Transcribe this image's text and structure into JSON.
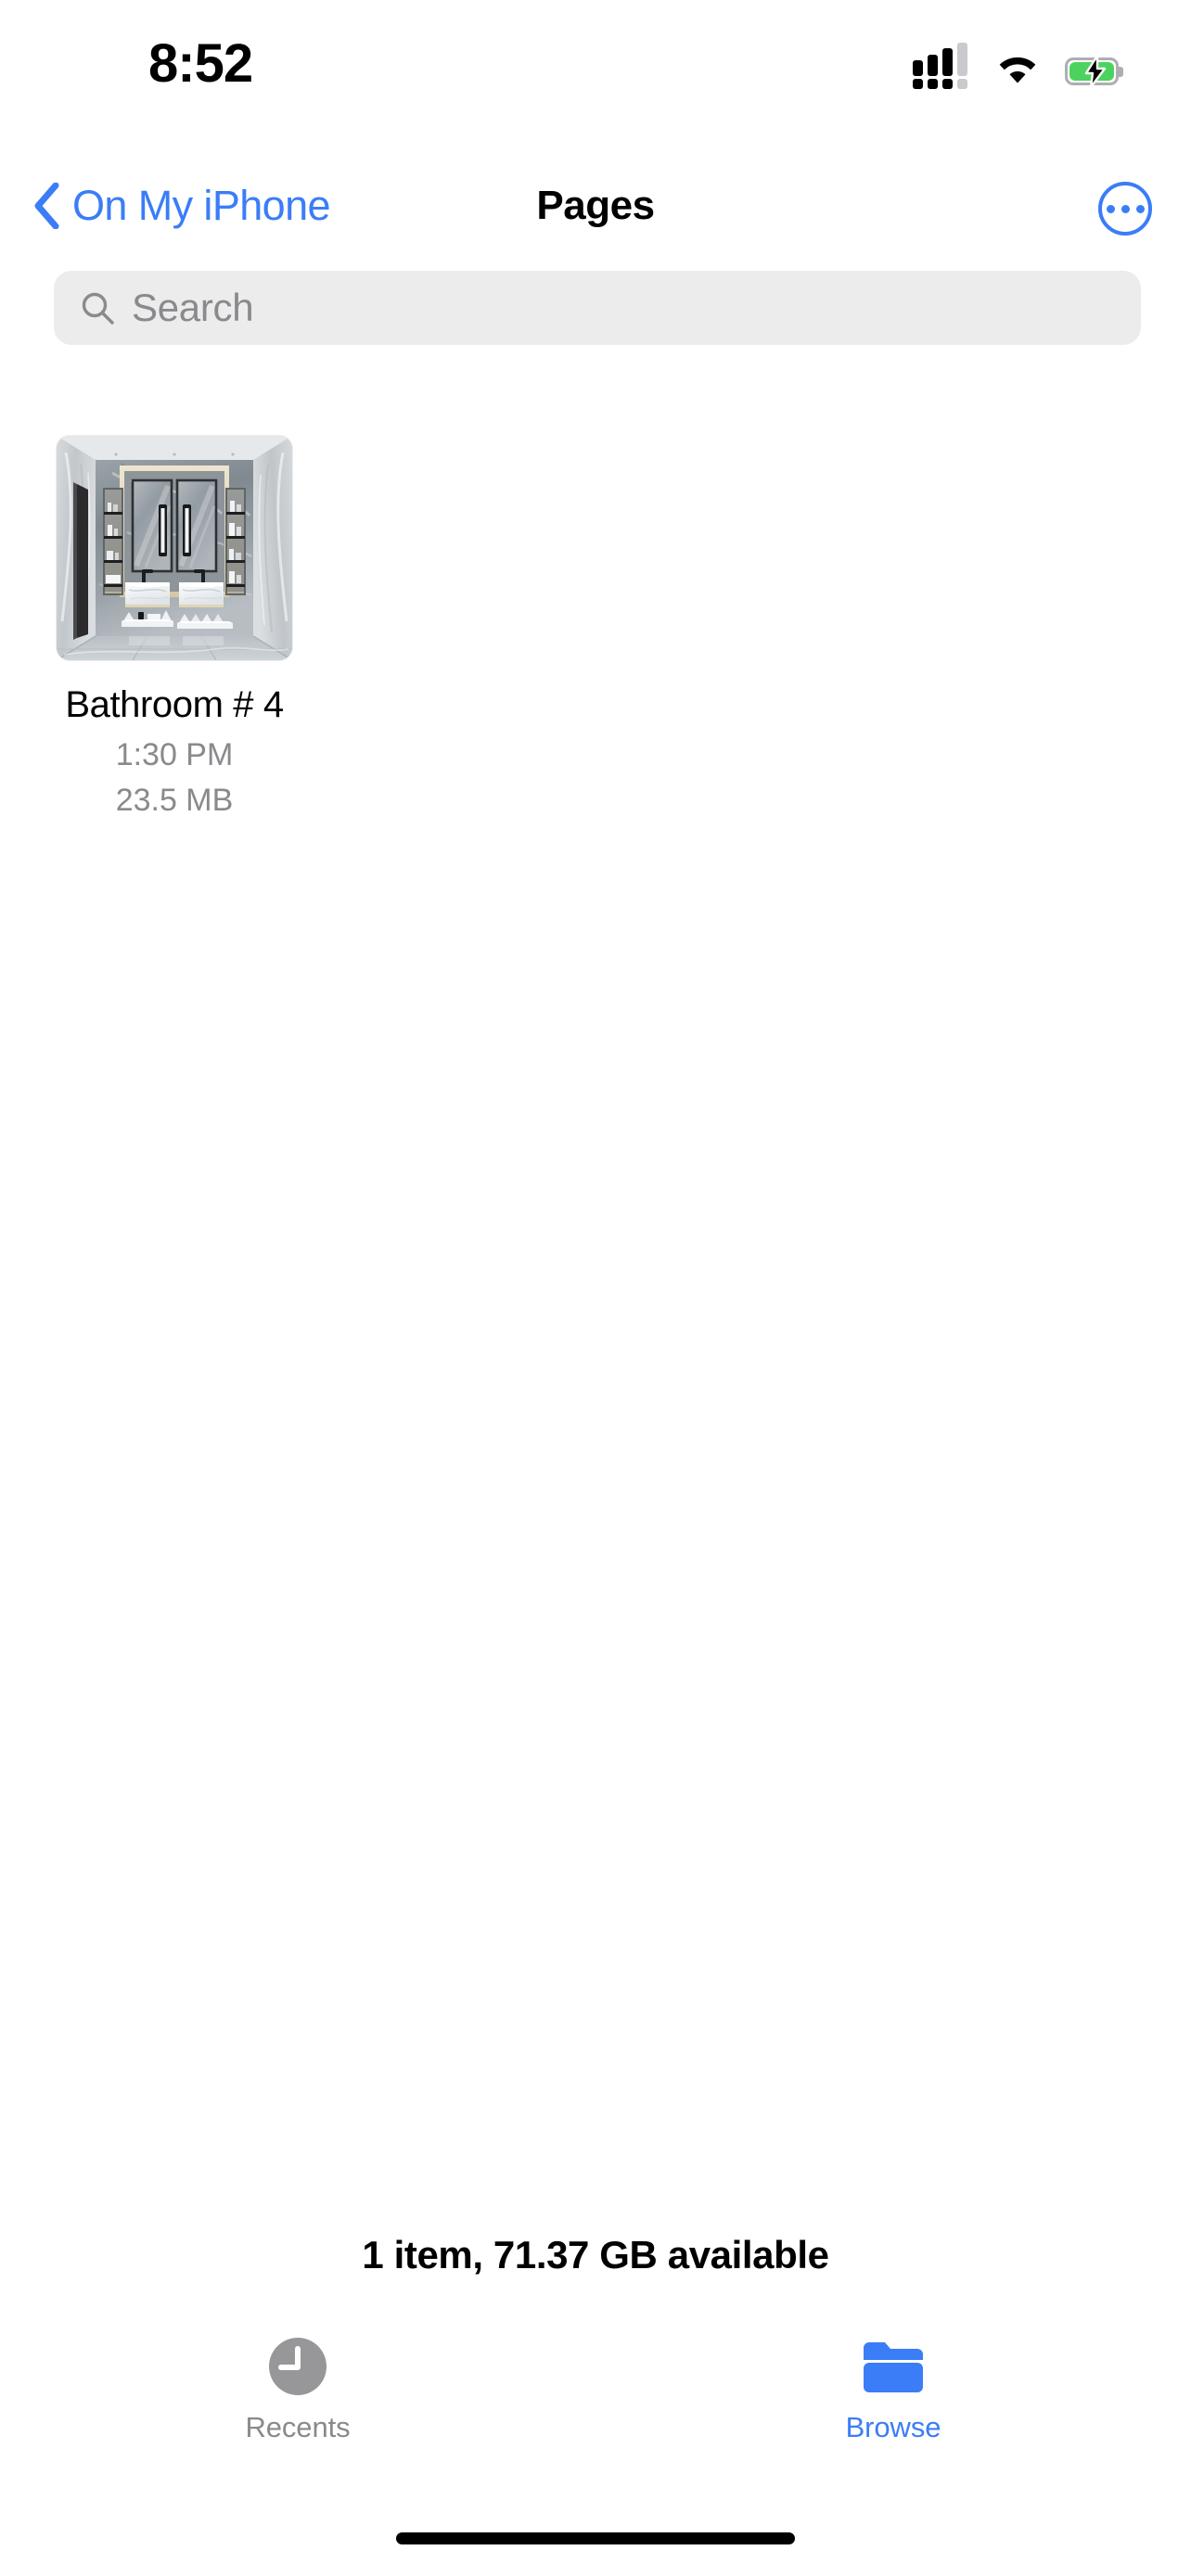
{
  "status_bar": {
    "time": "8:52",
    "cellular_icon": "cellular-signal-icon",
    "cellular_bars_total": 4,
    "cellular_bars_active": 3,
    "wifi_icon": "wifi-icon",
    "battery_icon": "battery-charging-icon",
    "battery_charging": true,
    "battery_color": "#4CD35F"
  },
  "nav_bar": {
    "back_label": "On My iPhone",
    "back_icon": "chevron-left-icon",
    "title": "Pages",
    "more_icon": "more-circle-icon"
  },
  "search": {
    "placeholder": "Search",
    "icon": "search-icon",
    "value": ""
  },
  "files": [
    {
      "name": "Bathroom # 4",
      "time": "1:30 PM",
      "size": "23.5 MB",
      "thumbnail": "bathroom-interior-thumbnail"
    }
  ],
  "footer": {
    "status": "1 item, 71.37 GB available"
  },
  "tab_bar": {
    "tabs": [
      {
        "label": "Recents",
        "icon": "clock-icon",
        "active": false
      },
      {
        "label": "Browse",
        "icon": "folder-icon",
        "active": true
      }
    ]
  },
  "colors": {
    "accent_blue": "#3B7DF7",
    "secondary_text": "#8A8A8E",
    "search_background": "#ECECEC",
    "battery_green": "#4CD35F"
  }
}
